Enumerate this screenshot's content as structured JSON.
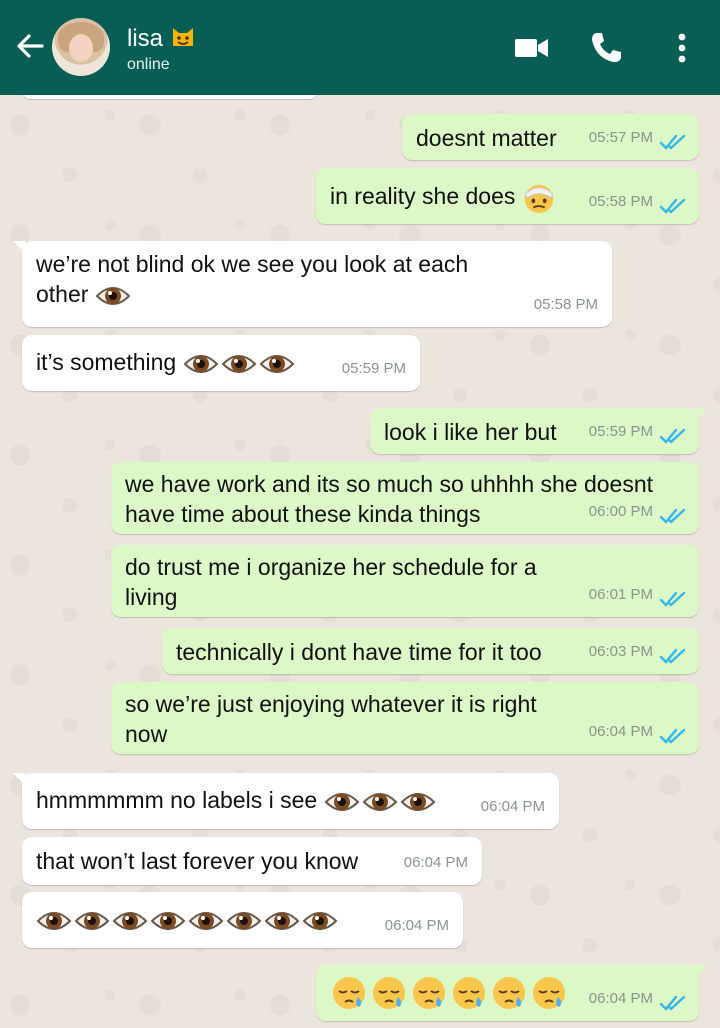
{
  "header": {
    "contact_name": "lisa",
    "name_emoji_icon": "smiling-cat-emoji",
    "status": "online",
    "icons": [
      "back-arrow-icon",
      "video-camera-icon",
      "phone-icon",
      "more-vertical-icon"
    ],
    "bar_color": "#075e54"
  },
  "colors": {
    "incoming": "#ffffff",
    "outgoing": "#dcf8c6",
    "read_ticks": "#34b7f1"
  },
  "messages": [
    {
      "dir": "out",
      "text": "doesnt matter",
      "time": "05:57 PM"
    },
    {
      "dir": "out",
      "text": "in reality she does",
      "emoji": [
        "face-with-head-bandage"
      ],
      "time": "05:58 PM"
    },
    {
      "dir": "in",
      "text": "we’re not blind ok we see you look at each",
      "text2": "other",
      "emoji": [
        "eye"
      ],
      "time": "05:58 PM"
    },
    {
      "dir": "in",
      "text": "it’s something",
      "emoji": [
        "eye",
        "eye",
        "eye"
      ],
      "time": "05:59 PM"
    },
    {
      "dir": "out",
      "text": "look i like her but",
      "time": "05:59 PM"
    },
    {
      "dir": "out",
      "text": "we have work and its so much so uhhhh she doesnt",
      "text2": "have time about these kinda things",
      "time": "06:00 PM"
    },
    {
      "dir": "out",
      "text": "do trust me i organize her schedule for a",
      "text2": "living",
      "time": "06:01 PM"
    },
    {
      "dir": "out",
      "text": "technically i dont have time for it too",
      "time": "06:03 PM"
    },
    {
      "dir": "out",
      "text": "so we’re just enjoying whatever it is right",
      "text2": "now",
      "time": "06:04 PM"
    },
    {
      "dir": "in",
      "text": "hmmmmmm no labels i see",
      "emoji": [
        "eye",
        "eye",
        "eye"
      ],
      "time": "06:04 PM"
    },
    {
      "dir": "in",
      "text": "that won’t last forever you know",
      "time": "06:04 PM"
    },
    {
      "dir": "in",
      "text": "",
      "emoji": [
        "eye",
        "eye",
        "eye",
        "eye",
        "eye",
        "eye",
        "eye",
        "eye"
      ],
      "time": "06:04 PM"
    },
    {
      "dir": "out",
      "text": "",
      "emoji": [
        "sleepy-face",
        "sleepy-face",
        "sleepy-face",
        "sleepy-face",
        "sleepy-face",
        "sleepy-face"
      ],
      "time": "06:04 PM"
    }
  ]
}
